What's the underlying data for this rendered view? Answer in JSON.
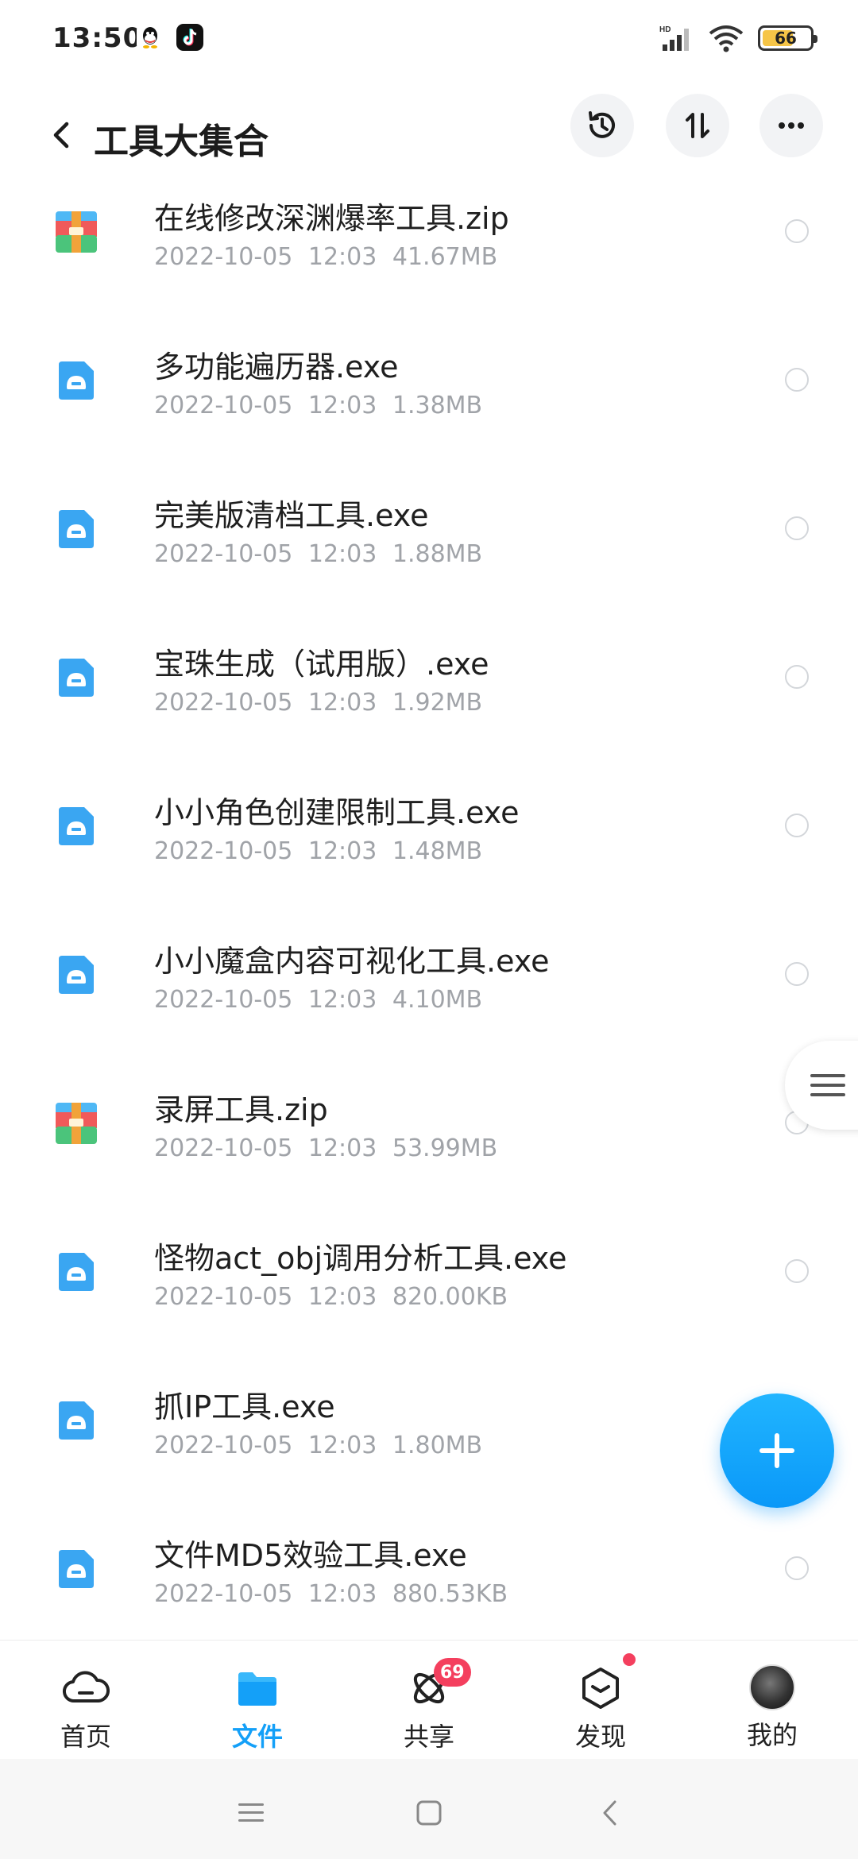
{
  "status_bar": {
    "time": "13:50",
    "battery_level": "66",
    "battery_fraction": 0.66,
    "network_label": "HD",
    "icons": [
      "qq-icon",
      "tiktok-icon",
      "signal-icon",
      "wifi-icon",
      "battery-icon"
    ]
  },
  "header": {
    "title": "工具大集合",
    "back_icon": "chevron-left-icon",
    "actions": [
      "history-icon",
      "sort-icon",
      "more-icon"
    ]
  },
  "files": [
    {
      "name": "在线修改深渊爆率工具.zip",
      "date": "2022-10-05",
      "time": "12:03",
      "size": "41.67MB",
      "type": "zip"
    },
    {
      "name": "多功能遍历器.exe",
      "date": "2022-10-05",
      "time": "12:03",
      "size": "1.38MB",
      "type": "exe"
    },
    {
      "name": "完美版清档工具.exe",
      "date": "2022-10-05",
      "time": "12:03",
      "size": "1.88MB",
      "type": "exe"
    },
    {
      "name": "宝珠生成（试用版）.exe",
      "date": "2022-10-05",
      "time": "12:03",
      "size": "1.92MB",
      "type": "exe"
    },
    {
      "name": "小小角色创建限制工具.exe",
      "date": "2022-10-05",
      "time": "12:03",
      "size": "1.48MB",
      "type": "exe"
    },
    {
      "name": "小小魔盒内容可视化工具.exe",
      "date": "2022-10-05",
      "time": "12:03",
      "size": "4.10MB",
      "type": "exe"
    },
    {
      "name": "录屏工具.zip",
      "date": "2022-10-05",
      "time": "12:03",
      "size": "53.99MB",
      "type": "zip"
    },
    {
      "name": "怪物act_obj调用分析工具.exe",
      "date": "2022-10-05",
      "time": "12:03",
      "size": "820.00KB",
      "type": "exe"
    },
    {
      "name": "抓IP工具.exe",
      "date": "2022-10-05",
      "time": "12:03",
      "size": "1.80MB",
      "type": "exe"
    },
    {
      "name": "文件MD5效验工具.exe",
      "date": "2022-10-05",
      "time": "12:03",
      "size": "880.53KB",
      "type": "exe"
    }
  ],
  "bottom_nav": {
    "items": [
      {
        "label": "首页",
        "icon": "cloud-home-icon"
      },
      {
        "label": "文件",
        "icon": "folder-icon",
        "active": true
      },
      {
        "label": "共享",
        "icon": "atom-share-icon",
        "badge": "69"
      },
      {
        "label": "发现",
        "icon": "discover-box-icon",
        "dot": true
      },
      {
        "label": "我的",
        "icon": "avatar"
      }
    ]
  },
  "colors": {
    "accent": "#14a0f8",
    "fab": "#0a98f8",
    "badge": "#f43f5e",
    "meta_text": "#a0a3a8",
    "exe_icon": "#3aa6f2",
    "zip_top": "#4fb8f5",
    "zip_mid": "#f1a33a",
    "zip_bottom": "#4bc47b"
  }
}
